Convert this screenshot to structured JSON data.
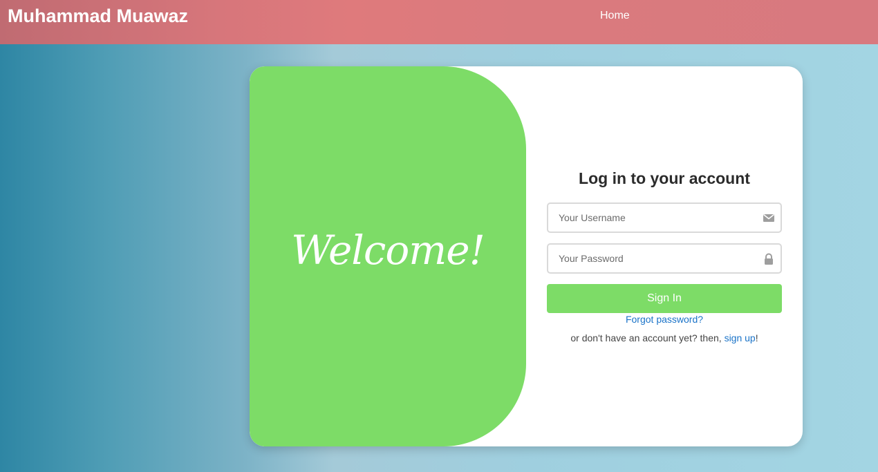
{
  "nav": {
    "brand": "Muhammad Muawaz",
    "home_label": "Home"
  },
  "welcome": {
    "text": "Welcome!"
  },
  "login": {
    "title": "Log in to your account",
    "username_placeholder": "Your Username",
    "username_icon": "envelope-icon",
    "password_placeholder": "Your Password",
    "password_icon": "lock-icon",
    "signin_label": "Sign In",
    "forgot_label": "Forgot password?",
    "signup_prefix": "or don't have an account yet? then, ",
    "signup_link": "sign up",
    "signup_suffix": "!"
  },
  "colors": {
    "accent_green": "#7ddc67",
    "link_blue": "#1a73c8",
    "navbar_pink": "#df7a7c"
  }
}
